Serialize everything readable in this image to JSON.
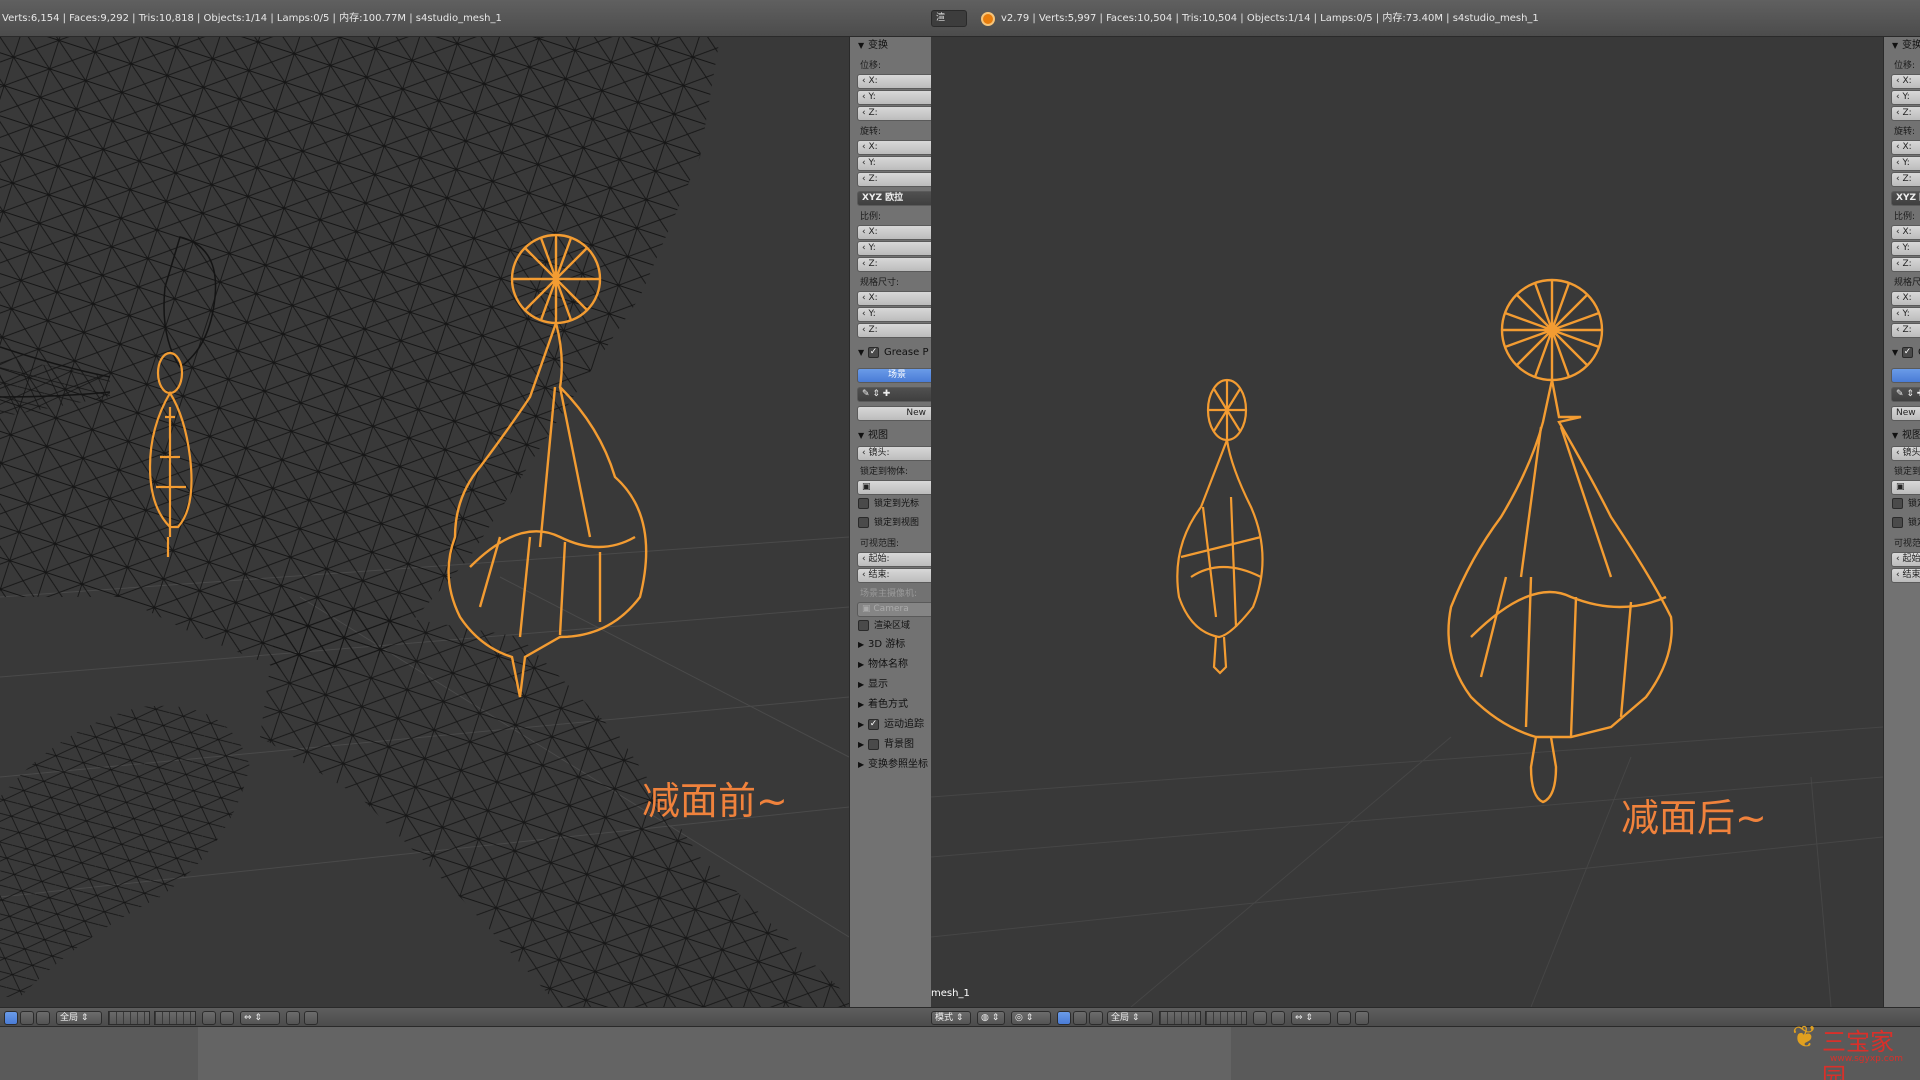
{
  "left_pane": {
    "info_stats": "Verts:6,154 | Faces:9,292 | Tris:10,818 | Objects:1/14 | Lamps:0/5 | 内存:100.77M | s4studio_mesh_1",
    "overlay_label": "减面前~"
  },
  "right_pane": {
    "mode_mini": "渲",
    "info_stats": "v2.79 | Verts:5,997 | Faces:10,504 | Tris:10,504 | Objects:1/14 | Lamps:0/5 | 内存:73.40M | s4studio_mesh_1",
    "overlay_label": "减面后~",
    "object_name_corner": "mesh_1"
  },
  "npanel": {
    "transform_header": "变换",
    "location_label": "位移:",
    "rotation_label": "旋转:",
    "rotation_mode": "XYZ 欧拉",
    "scale_label": "比例:",
    "dimensions_label": "规格尺寸:",
    "axis_x": "X:",
    "axis_y": "Y:",
    "axis_z": "Z:",
    "grease_pencil_header": "Grease P",
    "scene_button": "场景",
    "new_button": "New",
    "view_header": "视图",
    "lens_field": "镜头:",
    "lock_to_object_label": "锁定到物体:",
    "lock_to_cursor": "锁定到光标",
    "lock_camera_to_view": "锁定到视图",
    "clip_label": "可视范围:",
    "clip_start": "起始:",
    "clip_end": "结束:",
    "local_camera_label": "场景主摄像机:",
    "camera_field": "Camera",
    "render_border": "渲染区域",
    "collapsed_sections": [
      "3D 游标",
      "物体名称",
      "显示",
      "着色方式"
    ],
    "motion_tracking": "运动追踪",
    "background_images": "背景图",
    "transform_orientations": "变换参照坐标"
  },
  "toolbar": {
    "left_global": "全局",
    "right_mode": "模式",
    "right_global": "全局"
  },
  "watermark": {
    "text": "三宝家园",
    "url": "www.sgyxp.com"
  },
  "colors": {
    "wire_selected": "#f39c32",
    "wire_unselected": "#141414",
    "viewport_bg": "#393939",
    "label_orange": "#f0823c",
    "panel_bg": "#727272",
    "accent_blue": "#4a7cd6"
  }
}
